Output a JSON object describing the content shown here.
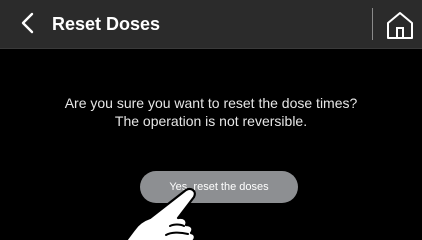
{
  "header": {
    "title": "Reset Doses",
    "back_icon": "chevron-left-icon",
    "home_icon": "home-icon"
  },
  "dialog": {
    "line1": "Are you sure you want to reset the dose times?",
    "line2": "The operation is not reversible.",
    "confirm_label": "Yes, reset the doses"
  },
  "colors": {
    "background": "#000000",
    "header": "#2b2b2b",
    "button": "#8d8f92",
    "text": "#ffffff"
  }
}
